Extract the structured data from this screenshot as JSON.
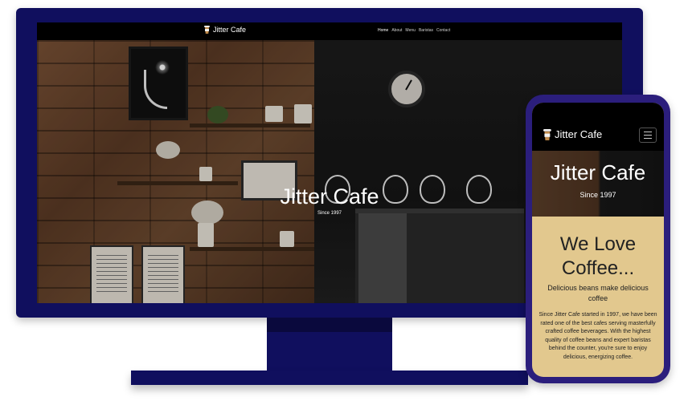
{
  "desktop": {
    "brand": "Jitter Cafe",
    "nav": [
      "Home",
      "About",
      "Menu",
      "Baristas",
      "Contact"
    ],
    "active_nav": "Home",
    "hero_title": "Jitter Cafe",
    "hero_subtitle": "Since 1997"
  },
  "mobile": {
    "brand": "Jitter Cafe",
    "menu_toggle_icon": "hamburger-icon",
    "hero_title": "Jitter Cafe",
    "hero_subtitle": "Since 1997",
    "heading": "We Love Coffee...",
    "subheading": "Delicious beans make delicious coffee",
    "body": "Since Jitter Cafe started in 1997, we have been rated one of the best cafes serving masterfully crafted coffee beverages. With the highest quality of coffee beans and expert baristas behind the counter, you're sure to enjoy delicious, energizing coffee."
  },
  "colors": {
    "device_frame": "#100f5e",
    "phone_frame": "#2b1e7c",
    "navbar": "#000000",
    "content_background": "#e2c88e"
  }
}
